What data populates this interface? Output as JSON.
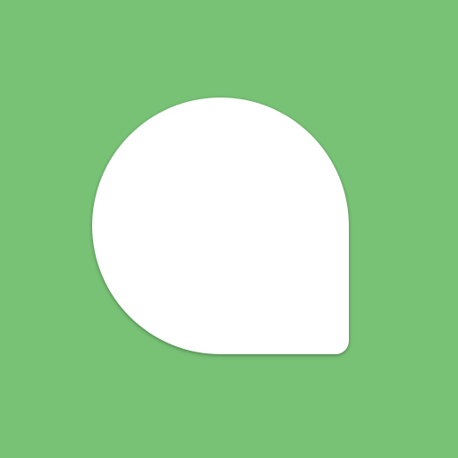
{
  "app": {
    "icon": "speech-bubble-icon",
    "colors": {
      "background": "#78c276",
      "icon_fill": "#ffffff"
    }
  }
}
